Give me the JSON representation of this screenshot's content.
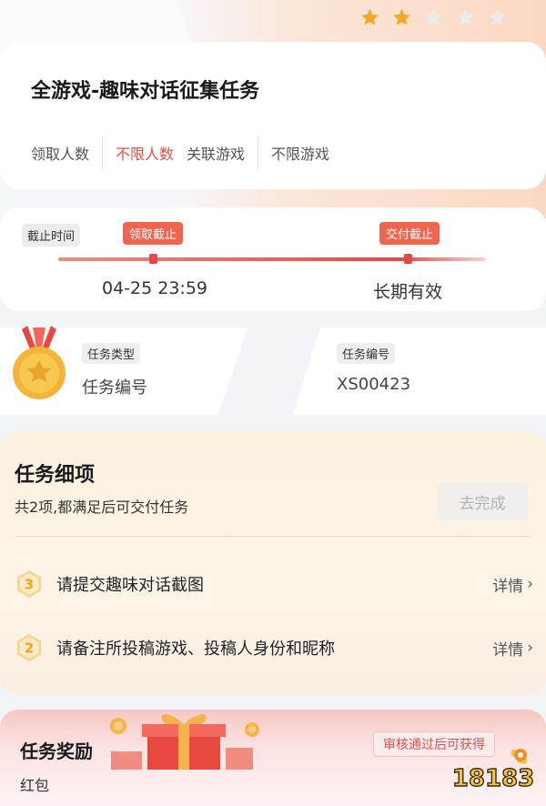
{
  "rating": {
    "filled": 2,
    "total": 5,
    "filled_color": "#f5a623",
    "empty_color": "#e6e6e6"
  },
  "header": {
    "title": "全游戏-趣味对话征集任务",
    "claim_label": "领取人数",
    "claim_value": "不限人数",
    "game_label": "关联游戏",
    "game_value": "不限游戏"
  },
  "deadline": {
    "label": "截止时间",
    "claim_deadline_chip": "领取截止",
    "submit_deadline_chip": "交付截止",
    "claim_deadline_value": "04-25 23:59",
    "submit_deadline_value": "长期有效"
  },
  "info": {
    "type_label": "任务类型",
    "type_value": "任务编号",
    "id_label": "任务编号",
    "id_value": "XS00423"
  },
  "details": {
    "title": "任务细项",
    "subtitle": "共2项,都满足后可交付任务",
    "button_label": "去完成",
    "items": [
      {
        "number": "3",
        "text": "请提交趣味对话截图",
        "link": "详情"
      },
      {
        "number": "2",
        "text": "请备注所投稿游戏、投稿人身份和昵称",
        "link": "详情"
      }
    ]
  },
  "reward": {
    "title": "任务奖励",
    "condition": "审核通过后可获得",
    "value": "红包"
  },
  "watermark": {
    "text": "18183"
  },
  "colors": {
    "accent": "#e0504b",
    "gold": "#f2b53a"
  }
}
